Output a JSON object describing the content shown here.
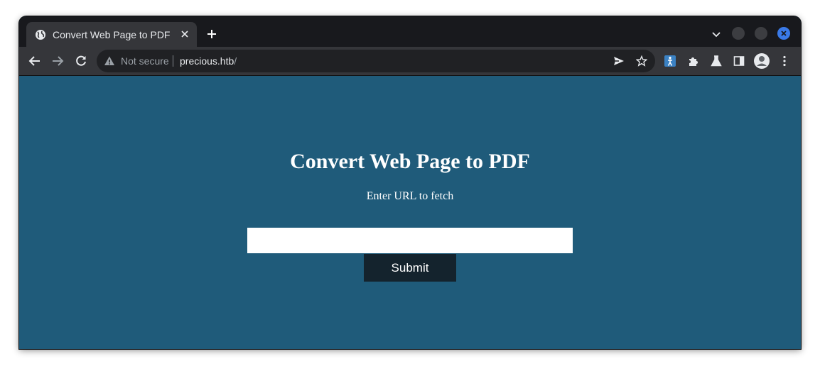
{
  "browser": {
    "tab": {
      "title": "Convert Web Page to PDF",
      "favicon": "globe-icon"
    },
    "omnibox": {
      "security_label": "Not secure",
      "url_host": "precious.htb",
      "url_path": "/"
    },
    "colors": {
      "frame": "#18191d",
      "toolbar": "#35363a",
      "omnibox": "#202124",
      "close_button": "#3a7ae8"
    }
  },
  "page": {
    "heading": "Convert Web Page to PDF",
    "subtitle": "Enter URL to fetch",
    "url_input": {
      "value": "",
      "placeholder": ""
    },
    "submit_label": "Submit",
    "colors": {
      "background": "#1f5b7a",
      "button": "#14232d",
      "text": "#ffffff"
    }
  }
}
